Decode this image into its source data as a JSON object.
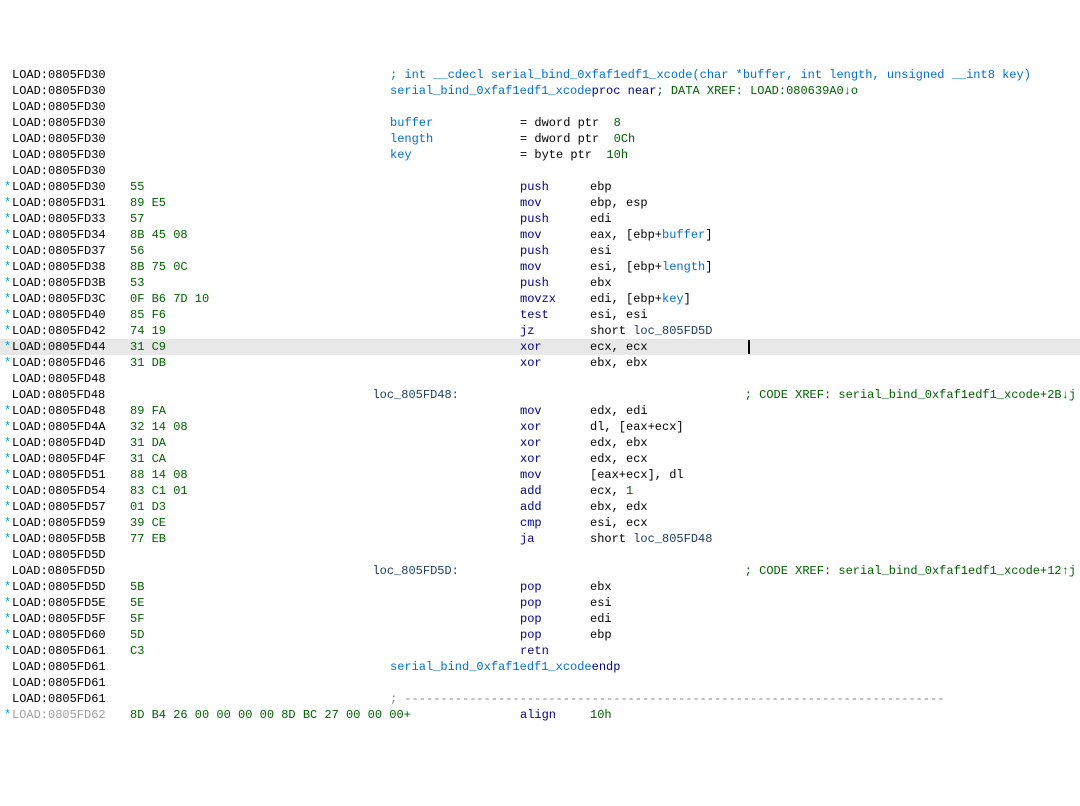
{
  "seg": "LOAD",
  "func_name": "serial_bind_0xfaf1edf1_xcode",
  "sig": "; int __cdecl serial_bind_0xfaf1edf1_xcode(char *buffer, int length, unsigned __int8 key)",
  "proc_near": "proc near",
  "xref_header": "; DATA XREF: LOAD:080639A0↓o",
  "args": [
    {
      "name": "buffer",
      "decl": "= dword ptr  8"
    },
    {
      "name": "length",
      "decl": "= dword ptr  0Ch"
    },
    {
      "name": "key",
      "decl": "= byte ptr  10h"
    }
  ],
  "loc48": "loc_805FD48:",
  "loc5d": "loc_805FD5D:",
  "xref_48": "; CODE XREF: serial_bind_0xfaf1edf1_xcode+2B↓j",
  "xref_5d": "; CODE XREF: serial_bind_0xfaf1edf1_xcode+12↑j",
  "endp": "serial_bind_0xfaf1edf1_xcode endp",
  "align": "align 10h",
  "lines": [
    {
      "p": " ",
      "a": "0805FD30",
      "b": "",
      "type": "sig"
    },
    {
      "p": " ",
      "a": "0805FD30",
      "b": "",
      "type": "proc"
    },
    {
      "p": " ",
      "a": "0805FD30",
      "b": "",
      "type": "blank"
    },
    {
      "p": " ",
      "a": "0805FD30",
      "b": "",
      "type": "arg",
      "ai": 0
    },
    {
      "p": " ",
      "a": "0805FD30",
      "b": "",
      "type": "arg",
      "ai": 1
    },
    {
      "p": " ",
      "a": "0805FD30",
      "b": "",
      "type": "arg",
      "ai": 2
    },
    {
      "p": " ",
      "a": "0805FD30",
      "b": "",
      "type": "blank"
    },
    {
      "p": "*",
      "a": "0805FD30",
      "b": "55",
      "m": "push",
      "o": "ebp"
    },
    {
      "p": "*",
      "a": "0805FD31",
      "b": "89 E5",
      "m": "mov",
      "o": "ebp, esp"
    },
    {
      "p": "*",
      "a": "0805FD33",
      "b": "57",
      "m": "push",
      "o": "edi"
    },
    {
      "p": "*",
      "a": "0805FD34",
      "b": "8B 45 08",
      "m": "mov",
      "o": "eax, [ebp+",
      "oarg": "buffer",
      "oend": "]"
    },
    {
      "p": "*",
      "a": "0805FD37",
      "b": "56",
      "m": "push",
      "o": "esi"
    },
    {
      "p": "*",
      "a": "0805FD38",
      "b": "8B 75 0C",
      "m": "mov",
      "o": "esi, [ebp+",
      "oarg": "length",
      "oend": "]"
    },
    {
      "p": "*",
      "a": "0805FD3B",
      "b": "53",
      "m": "push",
      "o": "ebx"
    },
    {
      "p": "*",
      "a": "0805FD3C",
      "b": "0F B6 7D 10",
      "m": "movzx",
      "o": "edi, [ebp+",
      "oarg": "key",
      "oend": "]"
    },
    {
      "p": "*",
      "a": "0805FD40",
      "b": "85 F6",
      "m": "test",
      "o": "esi, esi"
    },
    {
      "p": "*",
      "a": "0805FD42",
      "b": "74 19",
      "m": "jz",
      "o": "short ",
      "olbl": "loc_805FD5D"
    },
    {
      "p": "*",
      "a": "0805FD44",
      "b": "31 C9",
      "m": "xor",
      "o": "ecx, ecx",
      "hl": true,
      "caret": true
    },
    {
      "p": "*",
      "a": "0805FD46",
      "b": "31 DB",
      "m": "xor",
      "o": "ebx, ebx"
    },
    {
      "p": " ",
      "a": "0805FD48",
      "b": "",
      "type": "blank"
    },
    {
      "p": " ",
      "a": "0805FD48",
      "b": "",
      "type": "loc48"
    },
    {
      "p": "*",
      "a": "0805FD48",
      "b": "89 FA",
      "m": "mov",
      "o": "edx, edi"
    },
    {
      "p": "*",
      "a": "0805FD4A",
      "b": "32 14 08",
      "m": "xor",
      "o": "dl, [eax+ecx]"
    },
    {
      "p": "*",
      "a": "0805FD4D",
      "b": "31 DA",
      "m": "xor",
      "o": "edx, ebx"
    },
    {
      "p": "*",
      "a": "0805FD4F",
      "b": "31 CA",
      "m": "xor",
      "o": "edx, ecx"
    },
    {
      "p": "*",
      "a": "0805FD51",
      "b": "88 14 08",
      "m": "mov",
      "o": "[eax+ecx], dl"
    },
    {
      "p": "*",
      "a": "0805FD54",
      "b": "83 C1 01",
      "m": "add",
      "o": "ecx, ",
      "oimm": "1"
    },
    {
      "p": "*",
      "a": "0805FD57",
      "b": "01 D3",
      "m": "add",
      "o": "ebx, edx"
    },
    {
      "p": "*",
      "a": "0805FD59",
      "b": "39 CE",
      "m": "cmp",
      "o": "esi, ecx"
    },
    {
      "p": "*",
      "a": "0805FD5B",
      "b": "77 EB",
      "m": "ja",
      "o": "short ",
      "olbl": "loc_805FD48"
    },
    {
      "p": " ",
      "a": "0805FD5D",
      "b": "",
      "type": "blank"
    },
    {
      "p": " ",
      "a": "0805FD5D",
      "b": "",
      "type": "loc5d"
    },
    {
      "p": "*",
      "a": "0805FD5D",
      "b": "5B",
      "m": "pop",
      "o": "ebx"
    },
    {
      "p": "*",
      "a": "0805FD5E",
      "b": "5E",
      "m": "pop",
      "o": "esi"
    },
    {
      "p": "*",
      "a": "0805FD5F",
      "b": "5F",
      "m": "pop",
      "o": "edi"
    },
    {
      "p": "*",
      "a": "0805FD60",
      "b": "5D",
      "m": "pop",
      "o": "ebp"
    },
    {
      "p": "*",
      "a": "0805FD61",
      "b": "C3",
      "m": "retn",
      "o": ""
    },
    {
      "p": " ",
      "a": "0805FD61",
      "b": "",
      "type": "endp"
    },
    {
      "p": " ",
      "a": "0805FD61",
      "b": "",
      "type": "blank"
    },
    {
      "p": " ",
      "a": "0805FD61",
      "b": "",
      "type": "sep"
    },
    {
      "p": "*",
      "a": "0805FD62",
      "b": "8D B4 26 00 00 00 00 8D BC 27 00 00 00+",
      "type": "align",
      "gray": true
    }
  ],
  "sep_text": "; ---------------------------------------------------------------------------"
}
